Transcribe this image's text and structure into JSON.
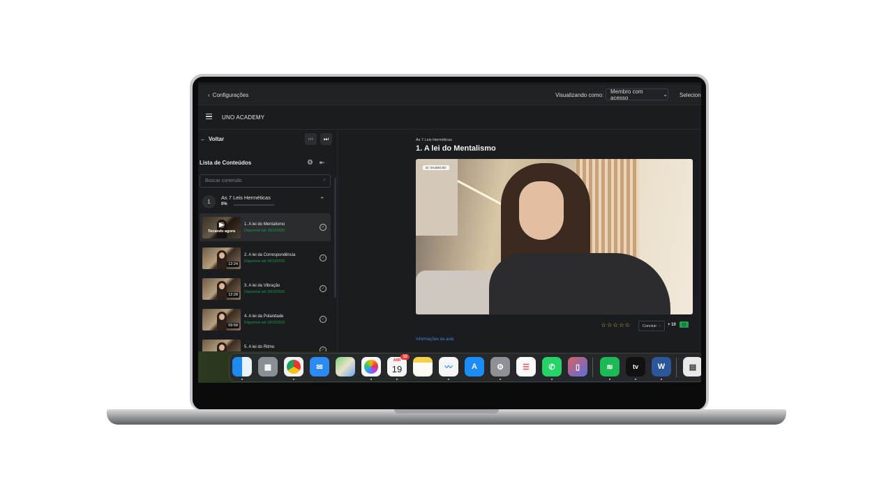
{
  "topbar": {
    "back_label": "Configurações",
    "viewing_label": "Visualizando como:",
    "member_select": "Membro com acesso",
    "select_more": "Seleciona"
  },
  "appbar": {
    "brand": "UNO ACADEMY"
  },
  "sidebar": {
    "back_label": "Voltar",
    "list_title": "Lista de Conteúdos",
    "search_placeholder": "Buscar conteúdo",
    "module": {
      "number": "1",
      "title": "As 7 Leis Herméticas",
      "progress_label": "0%",
      "progress": 0
    },
    "lessons": [
      {
        "title": "1. A lei do Mentalismo",
        "available": "Disponível até 18/10/2025",
        "duration": "",
        "playing_label": "Tocando agora",
        "active": true
      },
      {
        "title": "2. A lei da Correspondência",
        "available": "Disponível até 18/10/2025",
        "duration": "12:24",
        "active": false
      },
      {
        "title": "3. A lei da Vibração",
        "available": "Disponível até 18/10/2025",
        "duration": "12:28",
        "active": false
      },
      {
        "title": "4. A lei da Polaridade",
        "available": "Disponível até 18/10/2025",
        "duration": "09:58",
        "active": false
      },
      {
        "title": "5. A lei do Ritmo",
        "available": "",
        "duration": "",
        "active": false
      }
    ]
  },
  "main": {
    "breadcrumb": "As 7 Leis Herméticas",
    "lesson_title": "1. A lei do Mentalismo",
    "video_id_badge": "ID: 9A2B6C0D",
    "rating_stars": "☆☆☆☆☆",
    "rating": 0,
    "complete_label": "Concluir",
    "points_label": "+ 10",
    "info_link": "Informações da aula"
  },
  "dock": {
    "calendar_month": "ABR",
    "calendar_day": "19",
    "calendar_badge": "15"
  },
  "colors": {
    "background": "#1a1c1f",
    "available_green": "#1f9a4e",
    "link_blue": "#4a86e0",
    "star_gold": "#d8a93a"
  }
}
